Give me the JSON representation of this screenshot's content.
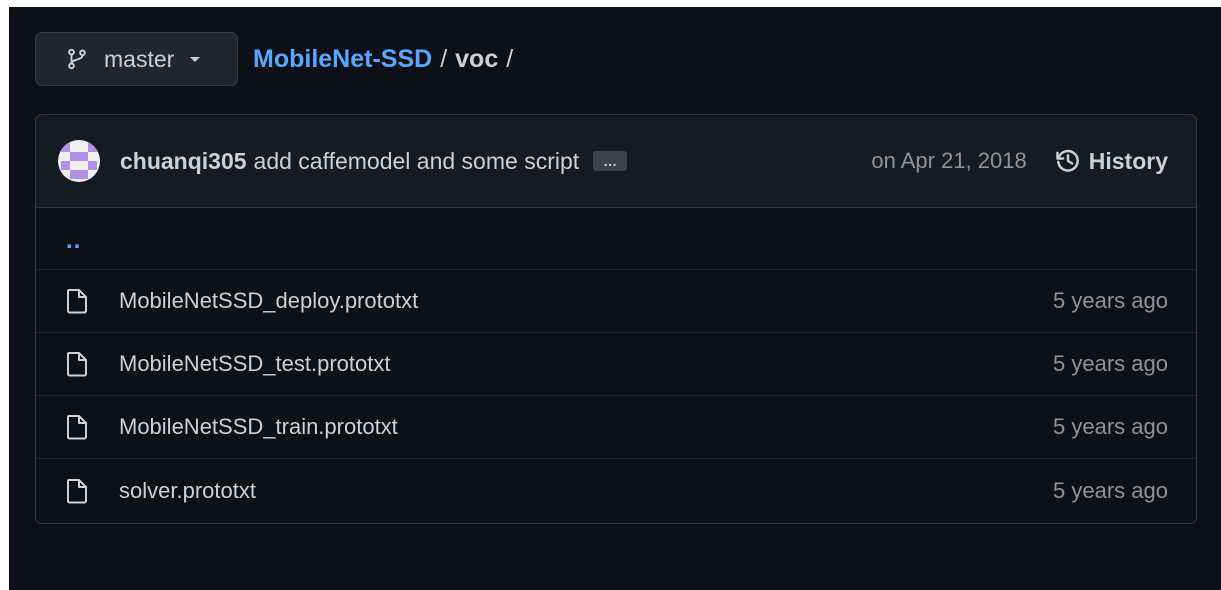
{
  "branch": {
    "label": "master",
    "icon": "git-branch-icon"
  },
  "breadcrumb": {
    "repo": "MobileNet-SSD",
    "separator": "/",
    "folder": "voc"
  },
  "commit": {
    "author": "chuanqi305",
    "message": "add caffemodel and some script",
    "ellipsis": "…",
    "date": "on Apr 21, 2018",
    "history_label": "History"
  },
  "parent_dir": "..",
  "files": [
    {
      "name": "MobileNetSSD_deploy.prototxt",
      "age": "5 years ago",
      "icon": "file-icon"
    },
    {
      "name": "MobileNetSSD_test.prototxt",
      "age": "5 years ago",
      "icon": "file-icon"
    },
    {
      "name": "MobileNetSSD_train.prototxt",
      "age": "5 years ago",
      "icon": "file-icon"
    },
    {
      "name": "solver.prototxt",
      "age": "5 years ago",
      "icon": "file-icon"
    }
  ],
  "colors": {
    "background": "#0d1117",
    "header_background": "#161b22",
    "link": "#58a6ff",
    "text": "#c9d1d9",
    "muted": "#8b949e",
    "border": "#30363d",
    "avatar": "#b190e8"
  }
}
